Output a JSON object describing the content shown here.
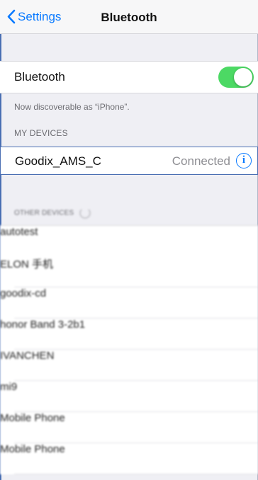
{
  "navbar": {
    "back_label": "Settings",
    "title": "Bluetooth"
  },
  "bluetooth": {
    "label": "Bluetooth",
    "enabled": true,
    "toggle_color": "#4cd964",
    "discoverable_text": "Now discoverable as “iPhone”."
  },
  "my_devices": {
    "header": "MY DEVICES",
    "items": [
      {
        "name": "Goodix_AMS_C",
        "status": "Connected",
        "icon": "info-icon"
      }
    ]
  },
  "other_devices": {
    "header": "OTHER DEVICES",
    "items": [
      {
        "name": "autotest"
      },
      {
        "name": "ELON 手机"
      },
      {
        "name": "goodix-cd"
      },
      {
        "name": "honor Band 3-2b1"
      },
      {
        "name": "IVANCHEN"
      },
      {
        "name": "mi9"
      },
      {
        "name": "Mobile Phone"
      },
      {
        "name": "Mobile Phone"
      }
    ]
  },
  "colors": {
    "accent": "#0a7aff",
    "background": "#efeff4"
  }
}
